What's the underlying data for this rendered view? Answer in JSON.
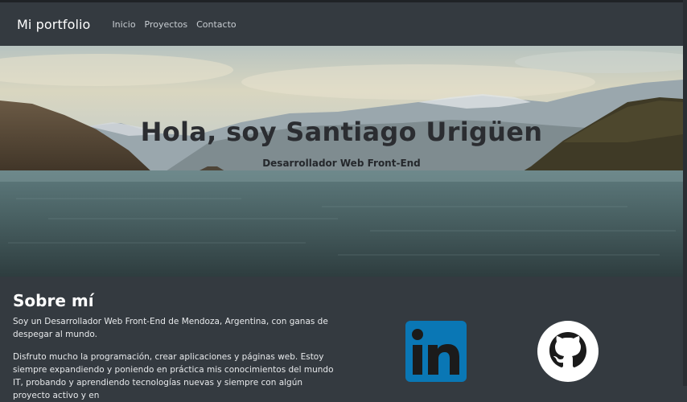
{
  "navbar": {
    "brand": "Mi portfolio",
    "links": [
      "Inicio",
      "Proyectos",
      "Contacto"
    ]
  },
  "hero": {
    "title": "Hola, soy Santiago Urigüen",
    "subtitle": "Desarrollador Web Front-End"
  },
  "about": {
    "heading": "Sobre mí",
    "paragraphs": [
      "Soy un Desarrollador Web Front-End de Mendoza, Argentina, con ganas de despegar al mundo.",
      "Disfruto mucho la programación, crear aplicaciones y páginas web. Estoy siempre expandiendo y poniendo en práctica mis conocimientos del mundo IT, probando y aprendiendo tecnologías nuevas y siempre con algún proyecto activo y en"
    ]
  },
  "social": {
    "linkedin_icon": "linkedin-icon",
    "github_icon": "github-icon"
  },
  "colors": {
    "page_bg": "#343a40",
    "linkedin": "#0a77b5",
    "hero_title": "#2b2d31"
  }
}
